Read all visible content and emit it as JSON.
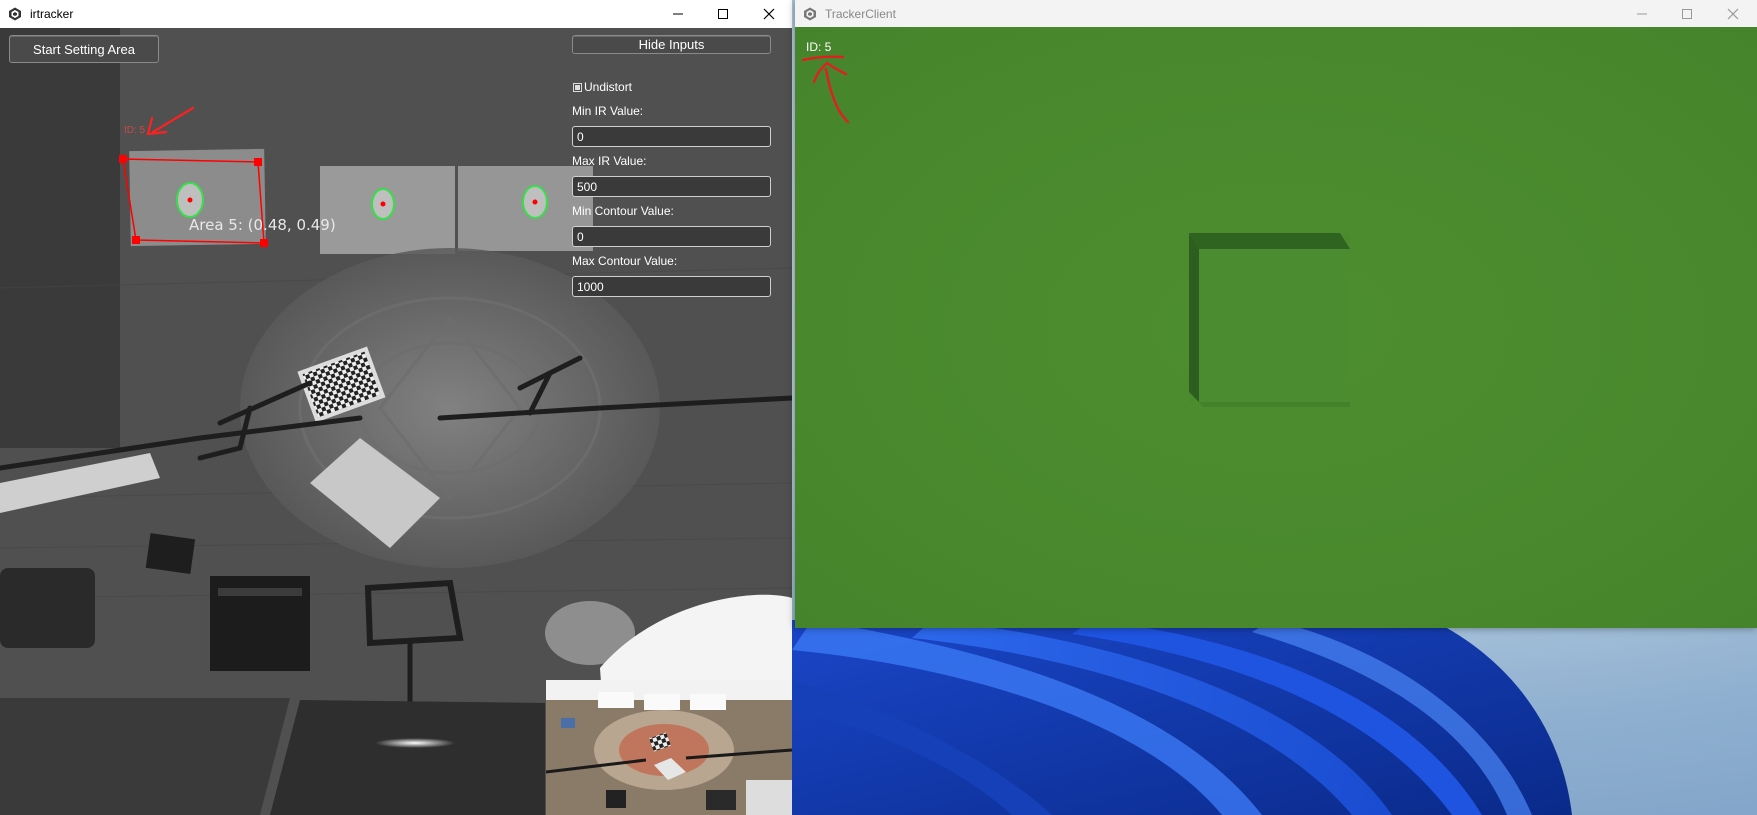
{
  "irtracker": {
    "title": "irtracker",
    "start_setting_area_label": "Start Setting Area",
    "hide_inputs_label": "Hide Inputs",
    "undistort_label": "Undistort",
    "undistort_checked": true,
    "fields": [
      {
        "label": "Min IR Value:",
        "value": "0"
      },
      {
        "label": "Max IR Value:",
        "value": "500"
      },
      {
        "label": "Min Contour Value:",
        "value": "0"
      },
      {
        "label": "Max Contour Value:",
        "value": "1000"
      }
    ],
    "area_label": "Area 5: (0.48, 0.49)",
    "area_tag": "ID: 5",
    "accent_color": "#ff0000",
    "blob_ring_color": "#37e04a"
  },
  "trackerclient": {
    "title": "TrackerClient",
    "id_label": "ID: 5",
    "background_color": "#4b8a2f"
  },
  "caption_icons": [
    "minimize-icon",
    "maximize-icon",
    "close-icon"
  ]
}
